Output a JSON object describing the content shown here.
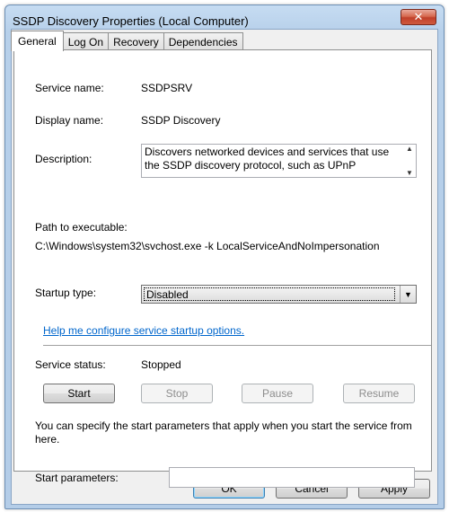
{
  "window": {
    "title": "SSDP Discovery Properties (Local Computer)",
    "close_glyph": "✕"
  },
  "tabs": [
    {
      "label": "General",
      "active": true
    },
    {
      "label": "Log On",
      "active": false
    },
    {
      "label": "Recovery",
      "active": false
    },
    {
      "label": "Dependencies",
      "active": false
    }
  ],
  "general": {
    "service_name_label": "Service name:",
    "service_name_value": "SSDPSRV",
    "display_name_label": "Display name:",
    "display_name_value": "SSDP Discovery",
    "description_label": "Description:",
    "description_value": "Discovers networked devices and services that use the SSDP discovery protocol, such as UPnP",
    "path_label": "Path to executable:",
    "path_value": "C:\\Windows\\system32\\svchost.exe -k LocalServiceAndNoImpersonation",
    "startup_type_label": "Startup type:",
    "startup_type_value": "Disabled",
    "help_link": "Help me configure service startup options.",
    "service_status_label": "Service status:",
    "service_status_value": "Stopped",
    "start_params_note": "You can specify the start parameters that apply when you start the service from here.",
    "start_params_label": "Start parameters:",
    "start_params_value": ""
  },
  "service_buttons": {
    "start": "Start",
    "stop": "Stop",
    "pause": "Pause",
    "resume": "Resume"
  },
  "dialog_buttons": {
    "ok": "OK",
    "cancel": "Cancel",
    "apply": "Apply"
  },
  "icons": {
    "close": "close-icon",
    "dropdown": "chevron-down-icon",
    "scroll_up": "scroll-up-icon",
    "scroll_down": "scroll-down-icon"
  },
  "colors": {
    "link": "#0066cc",
    "close_button": "#c0402a",
    "window_frame": "#b4cde8"
  }
}
